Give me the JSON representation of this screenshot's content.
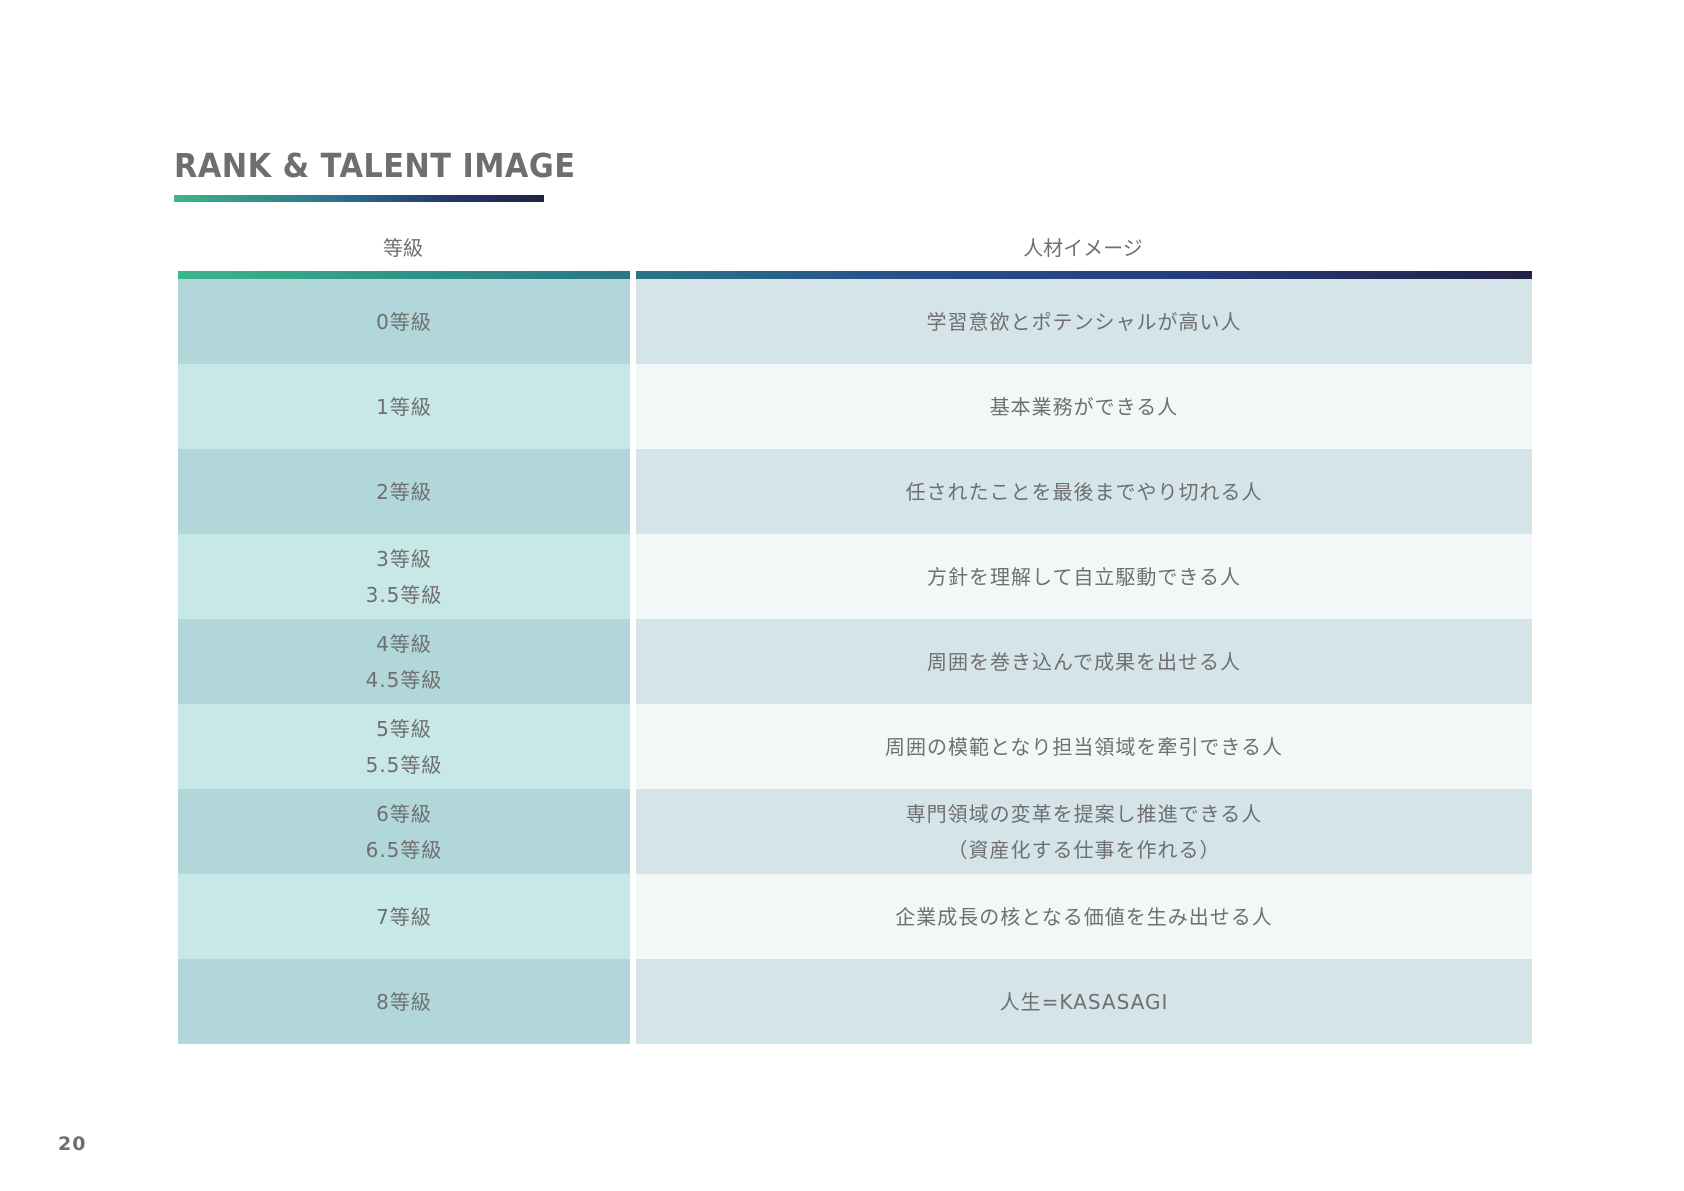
{
  "title": "RANK & TALENT IMAGE",
  "headers": {
    "rank": "等級",
    "image": "人材イメージ"
  },
  "rows": [
    {
      "rank": [
        "0等級"
      ],
      "image": [
        "学習意欲とポテンシャルが高い人"
      ]
    },
    {
      "rank": [
        "1等級"
      ],
      "image": [
        "基本業務ができる人"
      ]
    },
    {
      "rank": [
        "2等級"
      ],
      "image": [
        "任されたことを最後までやり切れる人"
      ]
    },
    {
      "rank": [
        "3等級",
        "3.5等級"
      ],
      "image": [
        "方針を理解して自立駆動できる人"
      ]
    },
    {
      "rank": [
        "4等級",
        "4.5等級"
      ],
      "image": [
        "周囲を巻き込んで成果を出せる人"
      ]
    },
    {
      "rank": [
        "5等級",
        "5.5等級"
      ],
      "image": [
        "周囲の模範となり担当領域を牽引できる人"
      ]
    },
    {
      "rank": [
        "6等級",
        "6.5等級"
      ],
      "image": [
        "専門領域の変革を提案し推進できる人",
        "（資産化する仕事を作れる）"
      ]
    },
    {
      "rank": [
        "7等級"
      ],
      "image": [
        "企業成長の核となる価値を生み出せる人"
      ]
    },
    {
      "rank": [
        "8等級"
      ],
      "image": [
        "人生=KASASAGI"
      ]
    }
  ],
  "page_number": "20"
}
